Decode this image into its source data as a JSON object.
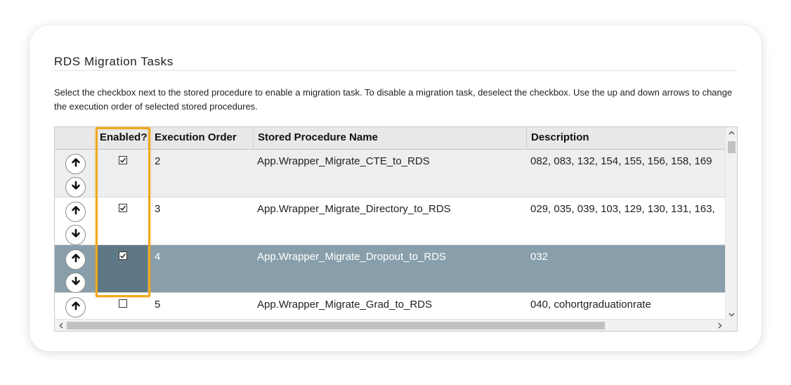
{
  "section": {
    "title": "RDS Migration Tasks",
    "instructions": "Select the checkbox next to the stored procedure to enable a migration task. To disable a migration task, deselect the checkbox. Use the up and down arrows to change the execution order of selected stored procedures."
  },
  "table": {
    "columns": {
      "enabled": "Enabled?",
      "execution_order": "Execution Order",
      "stored_procedure_name": "Stored Procedure Name",
      "description": "Description"
    },
    "rows": [
      {
        "enabled": true,
        "execution_order": "2",
        "stored_procedure_name": "App.Wrapper_Migrate_CTE_to_RDS",
        "description": "082, 083, 132, 154, 155, 156, 158, 169",
        "selected": false
      },
      {
        "enabled": true,
        "execution_order": "3",
        "stored_procedure_name": "App.Wrapper_Migrate_Directory_to_RDS",
        "description": "029, 035, 039, 103, 129, 130, 131, 163,",
        "selected": false
      },
      {
        "enabled": true,
        "execution_order": "4",
        "stored_procedure_name": "App.Wrapper_Migrate_Dropout_to_RDS",
        "description": "032",
        "selected": true
      },
      {
        "enabled": false,
        "execution_order": "5",
        "stored_procedure_name": "App.Wrapper_Migrate_Grad_to_RDS",
        "description": "040, cohortgraduationrate",
        "selected": false
      }
    ]
  },
  "icons": {
    "move_up": "arrow-up-icon",
    "move_down": "arrow-down-icon",
    "scroll_up": "chevron-up-icon",
    "scroll_down": "chevron-down-icon",
    "scroll_left": "chevron-left-icon",
    "scroll_right": "chevron-right-icon"
  },
  "colors": {
    "highlight": "#f0a81e",
    "selected_row": "#889fab",
    "selected_cell": "#5f7886",
    "alt_row": "#eceef0",
    "header": "#e8e8e8"
  }
}
